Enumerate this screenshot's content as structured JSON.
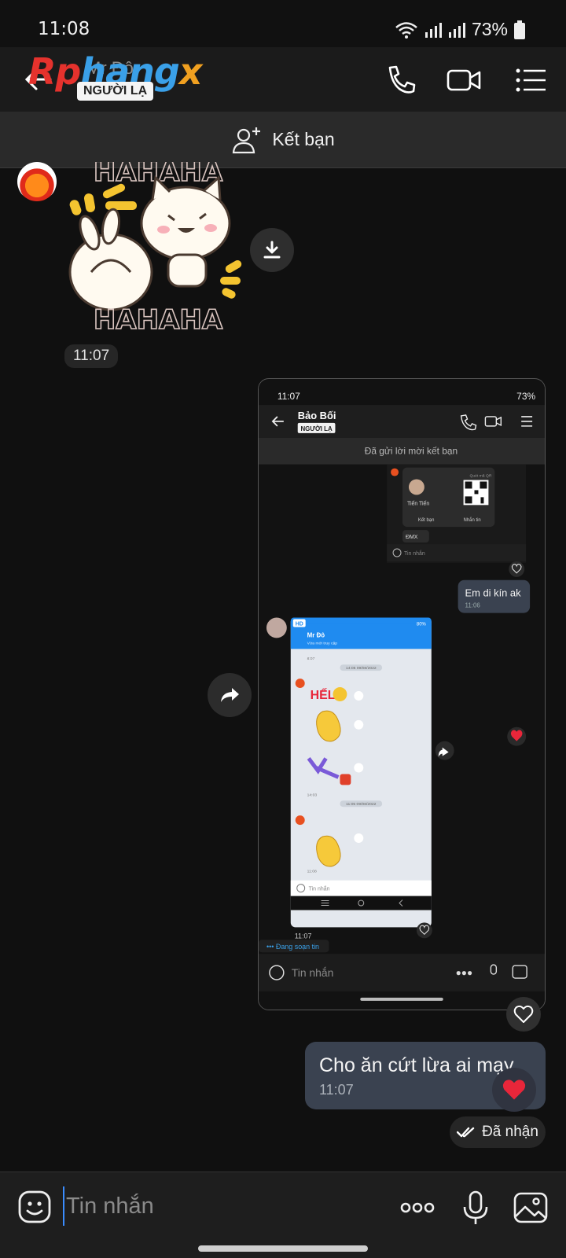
{
  "status": {
    "time": "11:08",
    "battery": "73%"
  },
  "header": {
    "logo": [
      "Rp",
      "hang",
      "x"
    ],
    "contact_name": "Mr Đô",
    "badge": "NGƯỜI LẠ"
  },
  "friend_bar": {
    "label": "Kết bạn"
  },
  "messages": {
    "sticker_top_text": "HAHAHA",
    "sticker_bottom_text": "HAHAHA",
    "sticker_time": "11:07",
    "my_text": "Cho ăn cứt lừa ai mạy",
    "my_time": "11:07",
    "received": "Đã nhận"
  },
  "inner": {
    "time": "11:07",
    "battery": "73%",
    "contact": "Bảo Bối",
    "badge": "NGƯỜI LẠ",
    "friend_sent": "Đã gửi lời mời kết bạn",
    "card_name": "Tiến Tiến",
    "card_add": "Kết bạn",
    "card_msg": "Nhắn tin",
    "card_scan": "Quét mã QR",
    "dmx": "ĐMX",
    "nested_placeholder": "Tin nhắn",
    "bubble_text": "Em di kín ak",
    "bubble_time": "11:06",
    "nested_contact": "Mr Đô",
    "nested_sub": "Vừa mới truy cập",
    "nested_date1": "14:05 09/08/2022",
    "nested_date2": "11:05 09/08/2022",
    "nested_time_a": "8:07",
    "nested_time_b": "14:03",
    "nested_time_c": "11:08",
    "nested_input": "Tin nhắn",
    "nested_status": "HD",
    "nested_batt": "80%",
    "shot_time": "11:07",
    "typing": "Đang soạn tin",
    "placeholder": "Tin nhắn"
  },
  "composer": {
    "placeholder": "Tin nhắn"
  },
  "colors": {
    "accent": "#3a8cff",
    "bubble_mine": "#3a4250",
    "heart": "#e8263a",
    "nested_bg": "#e4e8ee",
    "nested_header": "#1f8bf0"
  }
}
